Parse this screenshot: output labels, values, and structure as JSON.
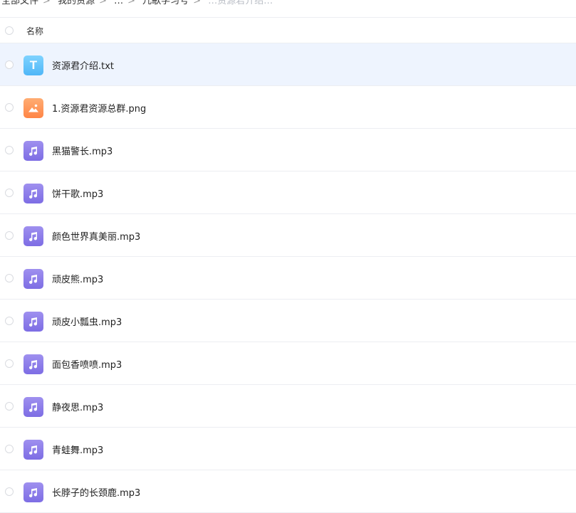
{
  "breadcrumb": {
    "items": [
      "全部文件",
      "我的资源",
      "…",
      "儿歌学习号",
      "…",
      "…资源君介绍…"
    ]
  },
  "header": {
    "column_name": "名称"
  },
  "files": [
    {
      "name": "资源君介绍.txt",
      "type": "txt",
      "selected": true
    },
    {
      "name": "1.资源君资源总群.png",
      "type": "image",
      "selected": false
    },
    {
      "name": "黑猫警长.mp3",
      "type": "audio",
      "selected": false
    },
    {
      "name": "饼干歌.mp3",
      "type": "audio",
      "selected": false
    },
    {
      "name": "颜色世界真美丽.mp3",
      "type": "audio",
      "selected": false
    },
    {
      "name": "顽皮熊.mp3",
      "type": "audio",
      "selected": false
    },
    {
      "name": "顽皮小瓢虫.mp3",
      "type": "audio",
      "selected": false
    },
    {
      "name": "面包香喷喷.mp3",
      "type": "audio",
      "selected": false
    },
    {
      "name": "静夜思.mp3",
      "type": "audio",
      "selected": false
    },
    {
      "name": "青蛙舞.mp3",
      "type": "audio",
      "selected": false
    },
    {
      "name": "长脖子的长颈鹿.mp3",
      "type": "audio",
      "selected": false
    }
  ],
  "icons": {
    "txt": "text-file-icon",
    "image": "image-file-icon",
    "audio": "music-file-icon"
  },
  "colors": {
    "selected_row": "#eef4fe",
    "txt_icon": "#4fb6f7",
    "image_icon": "#ff8546",
    "audio_icon": "#7d6de4"
  }
}
